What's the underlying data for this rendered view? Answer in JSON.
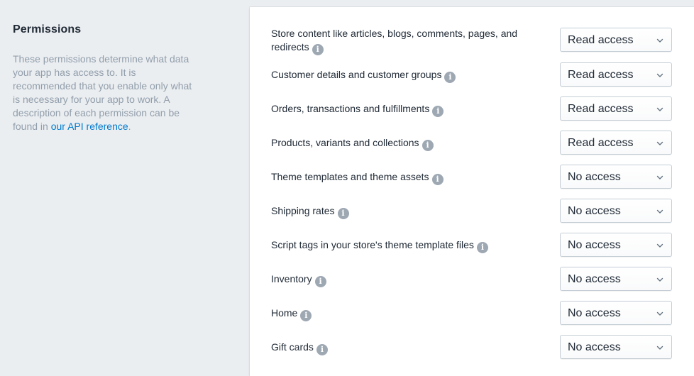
{
  "section": {
    "title": "Permissions",
    "description_lines": [
      "These permissions determine what data",
      "your app has access to. It is",
      "recommended that you enable only what",
      "is necessary for your app to work. A",
      "description of each permission can be"
    ],
    "description_last_prefix": "found in ",
    "link_text": "our API reference",
    "description_suffix": "."
  },
  "permissions": [
    {
      "label_line1": "Store content like articles, blogs, comments, pages, and",
      "label_line2": "redirects",
      "value": "Read access"
    },
    {
      "label": "Customer details and customer groups",
      "value": "Read access"
    },
    {
      "label": "Orders, transactions and fulfillments",
      "value": "Read access"
    },
    {
      "label": "Products, variants and collections",
      "value": "Read access"
    },
    {
      "label": "Theme templates and theme assets",
      "value": "No access"
    },
    {
      "label": "Shipping rates",
      "value": "No access"
    },
    {
      "label": "Script tags in your store's theme template files",
      "value": "No access"
    },
    {
      "label": "Inventory",
      "value": "No access"
    },
    {
      "label": "Home",
      "value": "No access"
    },
    {
      "label": "Gift cards",
      "value": "No access"
    }
  ],
  "icons": {
    "info": "info-icon",
    "chevron": "chevron-down-icon",
    "info_glyph": "i"
  },
  "colors": {
    "link": "#007ace",
    "muted": "#919eab",
    "info_badge": "#9ea8b3"
  }
}
